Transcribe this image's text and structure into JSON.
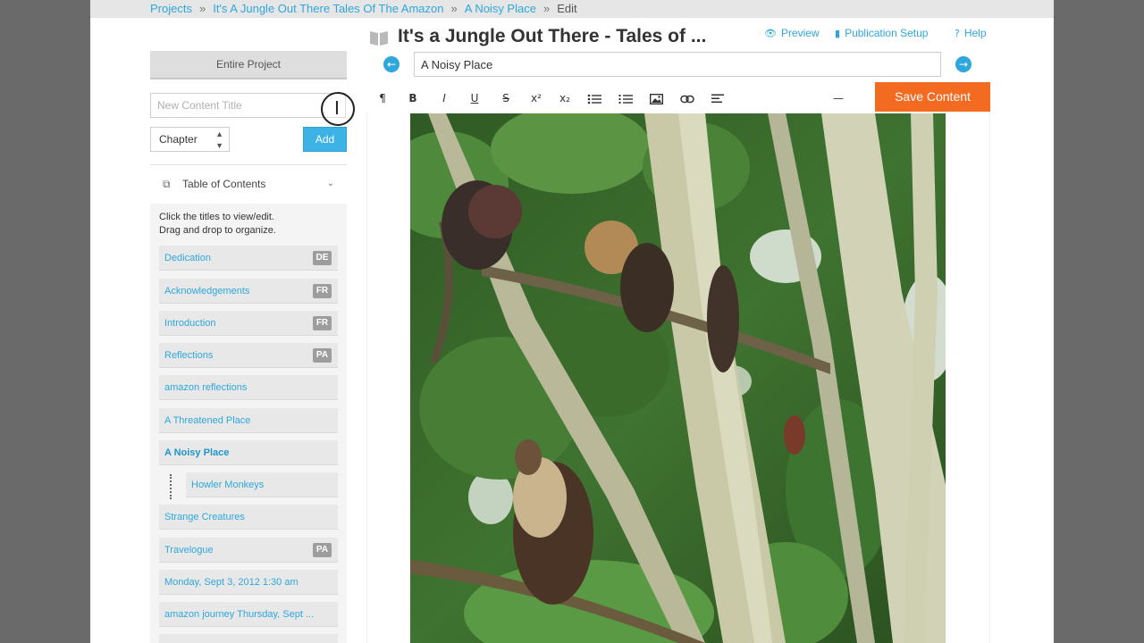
{
  "breadcrumb": {
    "projects": "Projects",
    "project": "It's A Jungle Out There Tales Of The Amazon",
    "chapter": "A Noisy Place",
    "current": "Edit",
    "separator": "»"
  },
  "sidebar": {
    "entire_project": "Entire Project",
    "new_title_placeholder": "New Content Title",
    "type_select_value": "Chapter",
    "add_label": "Add",
    "toc_title": "Table of Contents",
    "toc_help_line1": "Click the titles to view/edit.",
    "toc_help_line2": "Drag and drop to organize.",
    "items": [
      {
        "label": "Dedication",
        "badge": "DE"
      },
      {
        "label": "Acknowledgements",
        "badge": "FR"
      },
      {
        "label": "Introduction",
        "badge": "FR"
      },
      {
        "label": "Reflections",
        "badge": "PA"
      },
      {
        "label": "amazon reflections",
        "badge": ""
      },
      {
        "label": "A Threatened Place",
        "badge": ""
      },
      {
        "label": "A Noisy Place",
        "badge": ""
      },
      {
        "label": "Howler Monkeys",
        "badge": ""
      },
      {
        "label": "Strange Creatures",
        "badge": ""
      },
      {
        "label": "Travelogue",
        "badge": "PA"
      },
      {
        "label": "Monday, Sept 3, 2012 1:30 am",
        "badge": ""
      },
      {
        "label": "amazon journey Thursday, Sept ...",
        "badge": ""
      }
    ]
  },
  "header": {
    "title": "It's a Jungle Out There - Tales of ...",
    "preview": "Preview",
    "publication_setup": "Publication Setup",
    "help": "Help"
  },
  "editor": {
    "content_title": "A Noisy Place",
    "save_label": "Save Content",
    "toolbar": [
      "¶",
      "B",
      "I",
      "U",
      "S",
      "x²",
      "x₂",
      "bullet-list",
      "numbered-list",
      "image",
      "link",
      "align",
      "—"
    ]
  },
  "colors": {
    "accent": "#2ea7dd",
    "save": "#f26b21",
    "badge": "#9d9d9d"
  }
}
